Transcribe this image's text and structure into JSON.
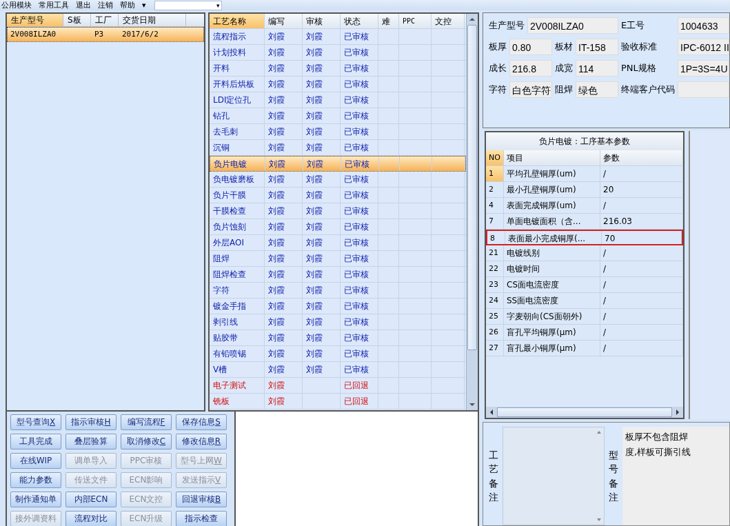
{
  "menu": {
    "items": [
      "公用模块",
      "常用工具",
      "退出",
      "注销",
      "帮助"
    ],
    "more": "▾",
    "dropdown": {
      "arrow": "▾"
    }
  },
  "model_list": {
    "columns": [
      {
        "label": "生产型号",
        "selected": true
      },
      {
        "label": "S板",
        "selected": false
      },
      {
        "label": "工厂",
        "selected": false
      },
      {
        "label": "交货日期",
        "selected": false
      }
    ],
    "rows": [
      {
        "cells": [
          "2V008ILZA0",
          "",
          "P3",
          "2017/6/2"
        ],
        "selected": true
      }
    ]
  },
  "process_grid": {
    "columns": [
      {
        "label": "工艺名称",
        "selected": true
      },
      {
        "label": "编写",
        "selected": false
      },
      {
        "label": "审核",
        "selected": false
      },
      {
        "label": "状态",
        "selected": false
      },
      {
        "label": "难",
        "selected": false
      },
      {
        "label": "PPC",
        "selected": false
      },
      {
        "label": "文控",
        "selected": false
      }
    ],
    "rows": [
      {
        "name": "流程指示",
        "writer": "刘霞",
        "reviewer": "刘霞",
        "status": "已审核",
        "returned": false,
        "selected": false
      },
      {
        "name": "计划投料",
        "writer": "刘霞",
        "reviewer": "刘霞",
        "status": "已审核",
        "returned": false,
        "selected": false
      },
      {
        "name": "开料",
        "writer": "刘霞",
        "reviewer": "刘霞",
        "status": "已审核",
        "returned": false,
        "selected": false
      },
      {
        "name": "开料后烘板",
        "writer": "刘霞",
        "reviewer": "刘霞",
        "status": "已审核",
        "returned": false,
        "selected": false
      },
      {
        "name": "LDI定位孔",
        "writer": "刘霞",
        "reviewer": "刘霞",
        "status": "已审核",
        "returned": false,
        "selected": false
      },
      {
        "name": "钻孔",
        "writer": "刘霞",
        "reviewer": "刘霞",
        "status": "已审核",
        "returned": false,
        "selected": false
      },
      {
        "name": "去毛刺",
        "writer": "刘霞",
        "reviewer": "刘霞",
        "status": "已审核",
        "returned": false,
        "selected": false
      },
      {
        "name": "沉铜",
        "writer": "刘霞",
        "reviewer": "刘霞",
        "status": "已审核",
        "returned": false,
        "selected": false
      },
      {
        "name": "负片电镀",
        "writer": "刘霞",
        "reviewer": "刘霞",
        "status": "已审核",
        "returned": false,
        "selected": true
      },
      {
        "name": "负电镀磨板",
        "writer": "刘霞",
        "reviewer": "刘霞",
        "status": "已审核",
        "returned": false,
        "selected": false
      },
      {
        "name": "负片干膜",
        "writer": "刘霞",
        "reviewer": "刘霞",
        "status": "已审核",
        "returned": false,
        "selected": false
      },
      {
        "name": "干膜检查",
        "writer": "刘霞",
        "reviewer": "刘霞",
        "status": "已审核",
        "returned": false,
        "selected": false
      },
      {
        "name": "负片蚀刻",
        "writer": "刘霞",
        "reviewer": "刘霞",
        "status": "已审核",
        "returned": false,
        "selected": false
      },
      {
        "name": "外层AOI",
        "writer": "刘霞",
        "reviewer": "刘霞",
        "status": "已审核",
        "returned": false,
        "selected": false
      },
      {
        "name": "阻焊",
        "writer": "刘霞",
        "reviewer": "刘霞",
        "status": "已审核",
        "returned": false,
        "selected": false
      },
      {
        "name": "阻焊检查",
        "writer": "刘霞",
        "reviewer": "刘霞",
        "status": "已审核",
        "returned": false,
        "selected": false
      },
      {
        "name": "字符",
        "writer": "刘霞",
        "reviewer": "刘霞",
        "status": "已审核",
        "returned": false,
        "selected": false
      },
      {
        "name": "镀金手指",
        "writer": "刘霞",
        "reviewer": "刘霞",
        "status": "已审核",
        "returned": false,
        "selected": false
      },
      {
        "name": "剥引线",
        "writer": "刘霞",
        "reviewer": "刘霞",
        "status": "已审核",
        "returned": false,
        "selected": false
      },
      {
        "name": "贴胶带",
        "writer": "刘霞",
        "reviewer": "刘霞",
        "status": "已审核",
        "returned": false,
        "selected": false
      },
      {
        "name": "有铅喷锡",
        "writer": "刘霞",
        "reviewer": "刘霞",
        "status": "已审核",
        "returned": false,
        "selected": false
      },
      {
        "name": "V槽",
        "writer": "刘霞",
        "reviewer": "刘霞",
        "status": "已审核",
        "returned": false,
        "selected": false
      },
      {
        "name": "电子测试",
        "writer": "刘霞",
        "reviewer": "",
        "status": "已回退",
        "returned": true,
        "selected": false
      },
      {
        "name": "铣板",
        "writer": "刘霞",
        "reviewer": "",
        "status": "已回退",
        "returned": true,
        "selected": false
      }
    ]
  },
  "buttons": [
    {
      "label": "型号查询",
      "hotkey": "X",
      "disabled": false
    },
    {
      "label": "指示审核",
      "hotkey": "H",
      "disabled": false
    },
    {
      "label": "编写流程",
      "hotkey": "F",
      "disabled": false
    },
    {
      "label": "保存信息",
      "hotkey": "S",
      "disabled": false
    },
    {
      "label": "工具完成",
      "disabled": false
    },
    {
      "label": "叠层验算",
      "disabled": false
    },
    {
      "label": "取消修改",
      "hotkey": "C",
      "disabled": false
    },
    {
      "label": "修改信息",
      "hotkey": "R",
      "disabled": false
    },
    {
      "label": "在线WIP",
      "disabled": false
    },
    {
      "label": "调单导入",
      "disabled": true
    },
    {
      "label": "PPC审核",
      "disabled": true
    },
    {
      "label": "型号上网",
      "hotkey": "W",
      "disabled": true
    },
    {
      "label": "能力参数",
      "disabled": false
    },
    {
      "label": "传送文件",
      "disabled": true
    },
    {
      "label": "ECN影响",
      "disabled": true
    },
    {
      "label": "发送指示",
      "hotkey": "V",
      "disabled": true
    },
    {
      "label": "制作通知单",
      "disabled": false
    },
    {
      "label": "内部ECN",
      "disabled": false
    },
    {
      "label": "ECN文控",
      "disabled": true
    },
    {
      "label": "回退审核",
      "hotkey": "B",
      "disabled": false
    },
    {
      "label": "接外调资料",
      "disabled": true
    },
    {
      "label": "流程对比",
      "disabled": false
    },
    {
      "label": "ECN升级",
      "disabled": true
    },
    {
      "label": "指示检查",
      "disabled": false
    }
  ],
  "info": {
    "fields": [
      {
        "label": "生产型号",
        "value": "2V008ILZA0"
      },
      {
        "label": "E工号",
        "value": "1004633"
      },
      {
        "label": "板厚",
        "value": "0.80"
      },
      {
        "label": "板材",
        "value": "IT-158"
      },
      {
        "label": "验收标准",
        "value": "IPC-6012 II"
      },
      {
        "label": "成长",
        "value": "216.8"
      },
      {
        "label": "成宽",
        "value": "114"
      },
      {
        "label": "PNL规格",
        "value": "1P=3S=4U"
      },
      {
        "label": "字符",
        "value": "白色字符"
      },
      {
        "label": "阻焊",
        "value": "绿色"
      },
      {
        "label": "终端客户代码"
      }
    ]
  },
  "params": {
    "title": "负片电镀：工序基本参数",
    "columns": [
      "NO",
      "项目",
      "参数"
    ],
    "rows": [
      {
        "no": "1",
        "item": "平均孔壁铜厚(um)",
        "value": "/",
        "selected": true,
        "highlighted": false
      },
      {
        "no": "2",
        "item": "最小孔壁铜厚(um)",
        "value": "20",
        "selected": false,
        "highlighted": false
      },
      {
        "no": "4",
        "item": "表面完成铜厚(um)",
        "value": "/",
        "selected": false,
        "highlighted": false
      },
      {
        "no": "7",
        "item": "单面电镀面积（含...",
        "value": "216.03",
        "selected": false,
        "highlighted": false
      },
      {
        "no": "8",
        "item": "表面最小完成铜厚(...",
        "value": "70",
        "selected": false,
        "highlighted": true
      },
      {
        "no": "21",
        "item": "电镀线别",
        "value": "/",
        "selected": false,
        "highlighted": false
      },
      {
        "no": "22",
        "item": "电镀时间",
        "value": "/",
        "selected": false,
        "highlighted": false
      },
      {
        "no": "23",
        "item": "CS面电流密度",
        "value": "/",
        "selected": false,
        "highlighted": false
      },
      {
        "no": "24",
        "item": "SS面电流密度",
        "value": "/",
        "selected": false,
        "highlighted": false
      },
      {
        "no": "25",
        "item": "字麦朝向(CS面朝外)",
        "value": "/",
        "selected": false,
        "highlighted": false
      },
      {
        "no": "26",
        "item": "盲孔平均铜厚(μm)",
        "value": "/",
        "selected": false,
        "highlighted": false
      },
      {
        "no": "27",
        "item": "盲孔最小铜厚(μm)",
        "value": "/",
        "selected": false,
        "highlighted": false
      }
    ]
  },
  "remarks": {
    "process_label": "工艺备注",
    "model_label": "型号备注",
    "model_lines": [
      "板厚不包含阻焊",
      "度,样板可撕引线"
    ]
  }
}
